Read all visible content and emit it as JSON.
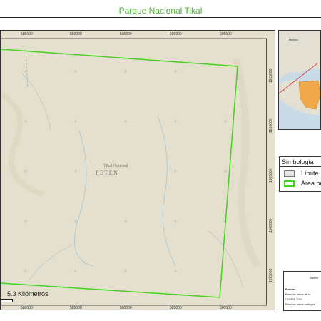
{
  "title": "Parque Nacional Tikal",
  "map": {
    "top_ticks": [
      "585000",
      "590000",
      "595000",
      "600000",
      "605000"
    ],
    "bottom_ticks": [
      "580000",
      "585000",
      "590000",
      "595000",
      "600000"
    ],
    "right_ticks": [
      "1915000",
      "1910000",
      "1905000",
      "1900000",
      "1895000"
    ],
    "place_small": "Tikal National",
    "place_large": "PETÉN",
    "scale_label": "5.3 Kilómetros",
    "colors": {
      "background": "#e4e0cd",
      "boundary": "#45d11f",
      "rivers": "#a7c3cf"
    }
  },
  "inset": {
    "label": "Mexico",
    "colors": {
      "sea": "#c8dbe6",
      "land": "#e3e0d3",
      "highlight": "#f1a84a",
      "pointer": "#e03030"
    }
  },
  "legend": {
    "title": "Simbologia",
    "items": [
      {
        "label": "Límite",
        "swatch_color": "#e6e6e6",
        "border_color": "#777777"
      },
      {
        "label": "Área pr",
        "swatch_color": "#ffffff",
        "border_color": "#45d11f"
      }
    ]
  },
  "info": {
    "top": "Sistem",
    "lines": [
      "Fuente:",
      "Base de datos de la",
      "CONAP 2016",
      "Base de datos cartogra"
    ]
  }
}
